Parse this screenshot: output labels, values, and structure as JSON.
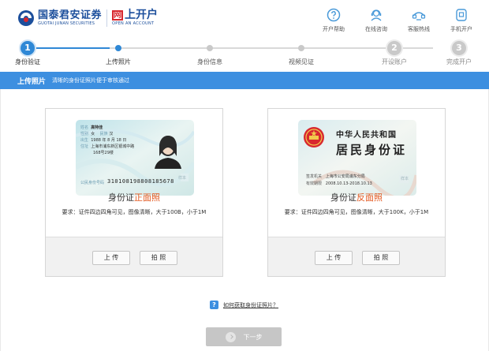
{
  "header": {
    "logo_cn": "国泰君安证券",
    "logo_en": "GUOTAI JUNAN SECURITIES",
    "logo2_box": "网",
    "logo2_cn": "上开户",
    "logo2_en": "OPEN AN ACCOUNT",
    "links": [
      {
        "label": "开户帮助",
        "icon": "help-icon"
      },
      {
        "label": "在线咨询",
        "icon": "headset-icon"
      },
      {
        "label": "客服热线",
        "icon": "phone-icon"
      },
      {
        "label": "手机开户",
        "icon": "mobile-icon"
      }
    ]
  },
  "steps": {
    "items": [
      {
        "label": "身份验证",
        "marker": "1"
      },
      {
        "label": "上传照片",
        "marker": ""
      },
      {
        "label": "身份信息",
        "marker": ""
      },
      {
        "label": "视频见证",
        "marker": ""
      },
      {
        "label": "开设账户",
        "marker": "2"
      },
      {
        "label": "完成开户",
        "marker": "3"
      }
    ]
  },
  "bar": {
    "title": "上传照片",
    "hint": "清晰的身份证照片便于审核通过"
  },
  "cards": [
    {
      "title_prefix": "身份证",
      "title_highlight": "正面照",
      "requirement": "要求：证件四边四角可见，图像清晰，大于100B，小于1M",
      "upload_label": "上 传",
      "photo_label": "拍 照",
      "id_front": {
        "name_key": "姓名",
        "name_val": "高特佳",
        "sex_key": "性别",
        "sex_val": "女",
        "nation_key": "民族",
        "nation_val": "汉",
        "birth_key": "出生",
        "birth_val": "1988  年  8  月  18 日",
        "addr_key": "住址",
        "addr_val1": "上海市浦东新区银城中路",
        "addr_val2": "168号29楼",
        "id_key": "公民身份号码",
        "id_val": "310108198808185678",
        "watermark": "样本"
      }
    },
    {
      "title_prefix": "身份证",
      "title_highlight": "反面照",
      "requirement": "要求：证件四边四角可见，图像清晰，大于100K，小于1M",
      "upload_label": "上 传",
      "photo_label": "拍 照",
      "id_back": {
        "country": "中华人民共和国",
        "card_name": "居民身份证",
        "authority_key": "签发机关",
        "authority_val": "上海市公安局浦东分局",
        "valid_key": "有效期限",
        "valid_val": "2008.10.13-2018.10.13",
        "watermark": "样本"
      }
    }
  ],
  "help_link": "如何获取身份证照片？",
  "help_icon_glyph": "?",
  "next_label": "下一步",
  "colors": {
    "accent_blue": "#3d8fe0",
    "step_blue": "#2f88d6",
    "highlight_orange": "#e2571e",
    "brand_navy": "#1c4f9c"
  }
}
